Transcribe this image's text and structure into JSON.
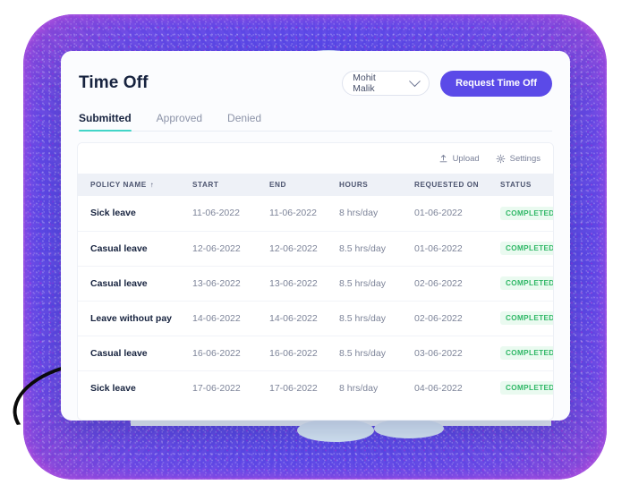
{
  "header": {
    "title": "Time Off",
    "user_select": {
      "value": "Mohit Malik",
      "icon": "chevron-down-icon"
    },
    "cta_label": "Request Time Off"
  },
  "tabs": [
    {
      "label": "Submitted",
      "active": true
    },
    {
      "label": "Approved",
      "active": false
    },
    {
      "label": "Denied",
      "active": false
    }
  ],
  "toolbar": {
    "upload_label": "Upload",
    "upload_icon": "upload-icon",
    "settings_label": "Settings",
    "settings_icon": "gear-icon"
  },
  "table": {
    "columns": [
      {
        "label": "POLICY NAME",
        "sort": "↑"
      },
      {
        "label": "START",
        "sort": ""
      },
      {
        "label": "END",
        "sort": ""
      },
      {
        "label": "HOURS",
        "sort": ""
      },
      {
        "label": "REQUESTED ON",
        "sort": ""
      },
      {
        "label": "STATUS",
        "sort": ""
      }
    ],
    "rows": [
      {
        "policy": "Sick leave",
        "start": "11-06-2022",
        "end": "11-06-2022",
        "hours": "8 hrs/day",
        "requested_on": "01-06-2022",
        "status": "COMPLETED"
      },
      {
        "policy": "Casual leave",
        "start": "12-06-2022",
        "end": "12-06-2022",
        "hours": "8.5 hrs/day",
        "requested_on": "01-06-2022",
        "status": "COMPLETED"
      },
      {
        "policy": "Casual leave",
        "start": "13-06-2022",
        "end": "13-06-2022",
        "hours": "8.5 hrs/day",
        "requested_on": "02-06-2022",
        "status": "COMPLETED"
      },
      {
        "policy": "Leave without pay",
        "start": "14-06-2022",
        "end": "14-06-2022",
        "hours": "8.5 hrs/day",
        "requested_on": "02-06-2022",
        "status": "COMPLETED"
      },
      {
        "policy": "Casual leave",
        "start": "16-06-2022",
        "end": "16-06-2022",
        "hours": "8.5 hrs/day",
        "requested_on": "03-06-2022",
        "status": "COMPLETED"
      },
      {
        "policy": "Sick leave",
        "start": "17-06-2022",
        "end": "17-06-2022",
        "hours": "8 hrs/day",
        "requested_on": "04-06-2022",
        "status": "COMPLETED"
      }
    ],
    "row_menu_icon": "kebab-menu-icon"
  },
  "colors": {
    "accent_purple": "#5b4ae8",
    "tab_underline": "#42d5c8",
    "status_green": "#2fb866",
    "status_green_bg": "#eafaf0",
    "title_ink": "#17233f",
    "backdrop_cloud": "#d8eaf8"
  }
}
